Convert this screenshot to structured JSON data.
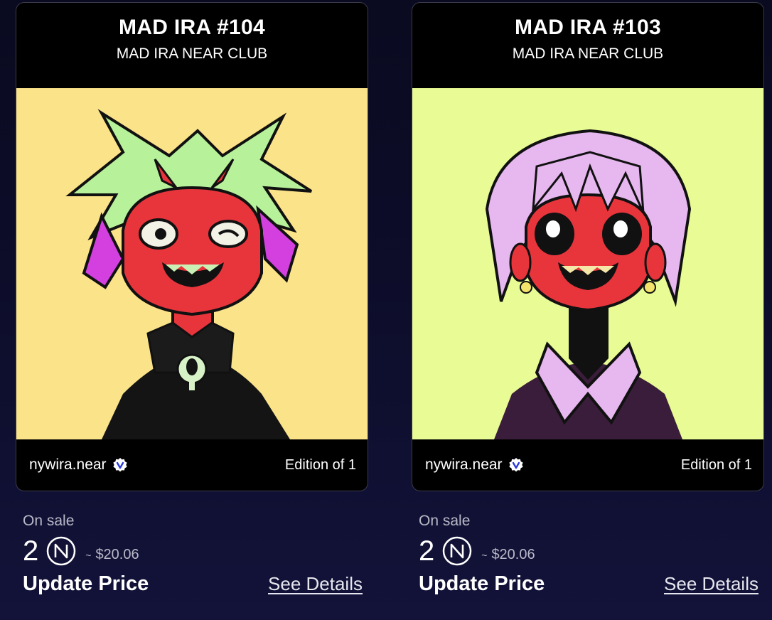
{
  "cards": [
    {
      "title": "MAD IRA #104",
      "collection": "MAD IRA NEAR CLUB",
      "owner": "nywira.near",
      "edition": "Edition of 1",
      "sale_status": "On sale",
      "price": "2",
      "usd_prefix": "~",
      "usd": "$20.06",
      "update_label": "Update Price",
      "details_label": "See Details",
      "art_bg": "#fbe38a"
    },
    {
      "title": "MAD IRA #103",
      "collection": "MAD IRA NEAR CLUB",
      "owner": "nywira.near",
      "edition": "Edition of 1",
      "sale_status": "On sale",
      "price": "2",
      "usd_prefix": "~",
      "usd": "$20.06",
      "update_label": "Update Price",
      "details_label": "See Details",
      "art_bg": "#e8fb94"
    }
  ],
  "icons": {
    "verified": "verified-badge-icon",
    "currency": "near-currency-icon"
  },
  "colors": {
    "page_bg": "#0e0e2e",
    "card_bg": "#000000",
    "muted_text": "#b9b9c8"
  }
}
